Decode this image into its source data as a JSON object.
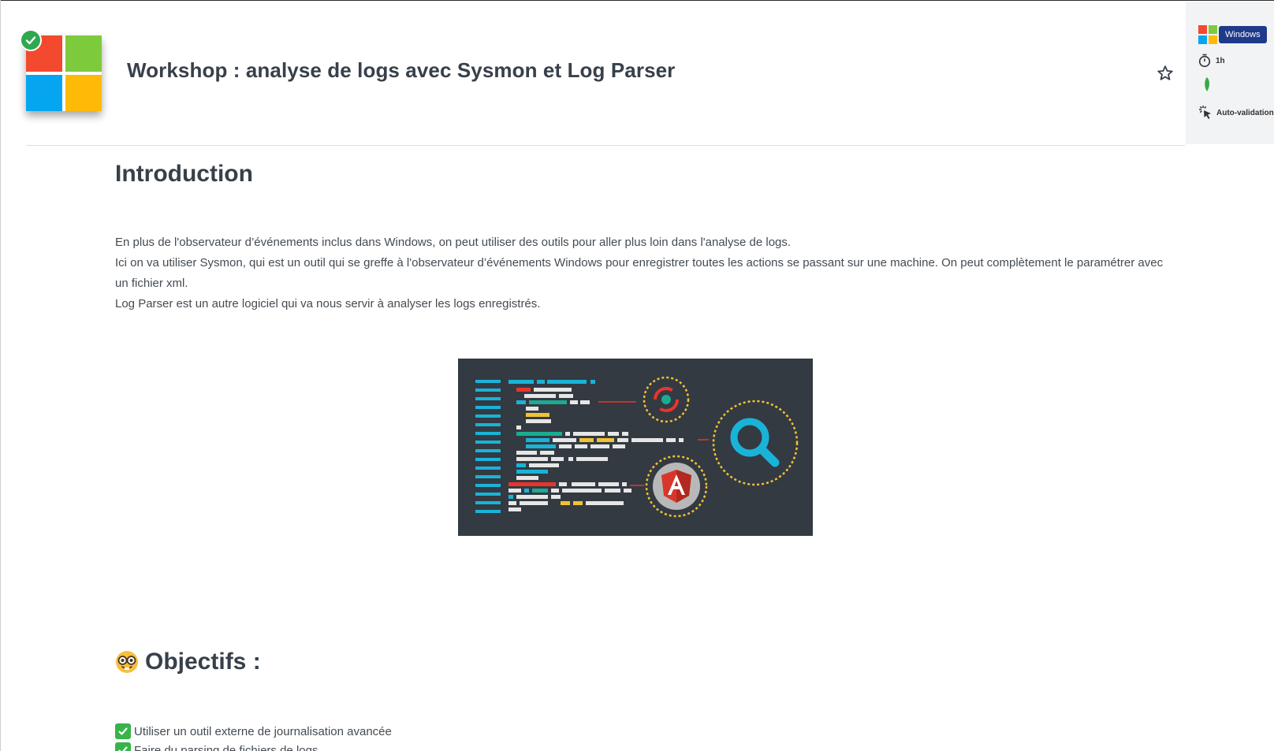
{
  "header": {
    "title": "Workshop : analyse de logs avec Sysmon et Log Parser"
  },
  "info_panel": {
    "os_label": "Windows",
    "duration": "1h",
    "validation_label": "Auto-validation"
  },
  "content": {
    "intro_heading": "Introduction",
    "paragraphs": [
      "En plus de l'observateur d’événements inclus dans Windows, on peut utiliser des outils pour aller plus loin dans l'analyse de logs.",
      "Ici on va utiliser Sysmon, qui est un outil qui se greffe à l'observateur d’événements Windows pour enregistrer toutes les actions se passant sur une machine. On peut complètement le paramétrer avec un fichier xml.",
      "Log Parser est un autre logiciel qui va nous servir à analyser les logs enregistrés."
    ],
    "objectives_heading": "Objectifs :",
    "objectives": [
      "Utiliser un outil externe de journalisation avancée",
      "Faire du parsing de fichiers de logs"
    ]
  },
  "colors": {
    "accent_dark": "#1f3a8a",
    "success": "#2fa84f",
    "text": "#37404a",
    "win_red": "#f3492f",
    "win_green": "#7dcb3c",
    "win_blue": "#05a6ef",
    "win_yellow": "#ffba08"
  },
  "icons": {
    "logo": "windows-logo",
    "completed": "check-circle-icon",
    "favorite": "star-outline-icon",
    "duration": "stopwatch-icon",
    "level": "leaf-icon",
    "validation": "cursor-click-icon",
    "objectives": "nerd-face-emoji",
    "objective_item": "check-mark-button-emoji"
  }
}
